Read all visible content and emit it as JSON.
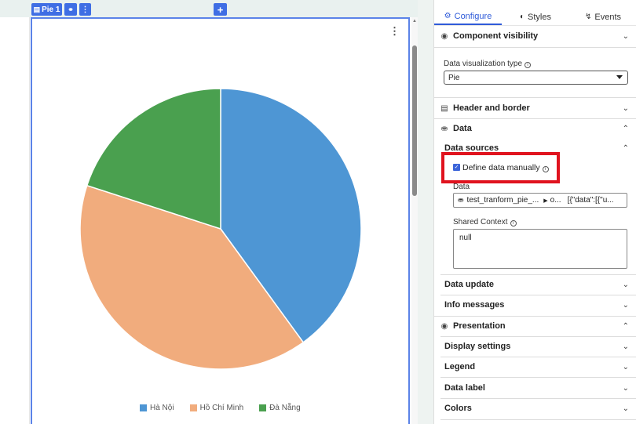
{
  "toolbar": {
    "component_chip": "Pie 1",
    "add_label": "+"
  },
  "chart_data": {
    "type": "pie",
    "slices": [
      {
        "name": "Hà Nội",
        "value": 40,
        "color": "#4e96d4"
      },
      {
        "name": "Hồ Chí Minh",
        "value": 40,
        "color": "#f1ac7d"
      },
      {
        "name": "Đà Nẵng",
        "value": 20,
        "color": "#4aa04f"
      }
    ],
    "start_angle_deg": 0,
    "legend_position": "bottom"
  },
  "panel": {
    "tabs": [
      {
        "label": "Configure",
        "icon": "gear-icon",
        "active": true
      },
      {
        "label": "Styles",
        "icon": "palette-icon",
        "active": false
      },
      {
        "label": "Events",
        "icon": "bolt-icon",
        "active": false
      }
    ],
    "component_visibility": "Component visibility",
    "viz_type_label": "Data visualization type",
    "viz_type_value": "Pie",
    "header_border": "Header and border",
    "data_section": "Data",
    "data_sources": "Data sources",
    "define_manually": "Define data manually",
    "data_label": "Data",
    "data_source_name": "test_tranform_pie_...",
    "data_source_out": "o...",
    "data_source_preview": "[{\"data\":[{\"u...",
    "shared_context_label": "Shared Context",
    "shared_context_value": "null",
    "data_update": "Data update",
    "info_messages": "Info messages",
    "presentation": "Presentation",
    "display_settings": "Display settings",
    "legend": "Legend",
    "data_label_section": "Data label",
    "colors": "Colors"
  },
  "colors": {
    "accent": "#3f6ee4",
    "highlight": "#e0131e"
  }
}
